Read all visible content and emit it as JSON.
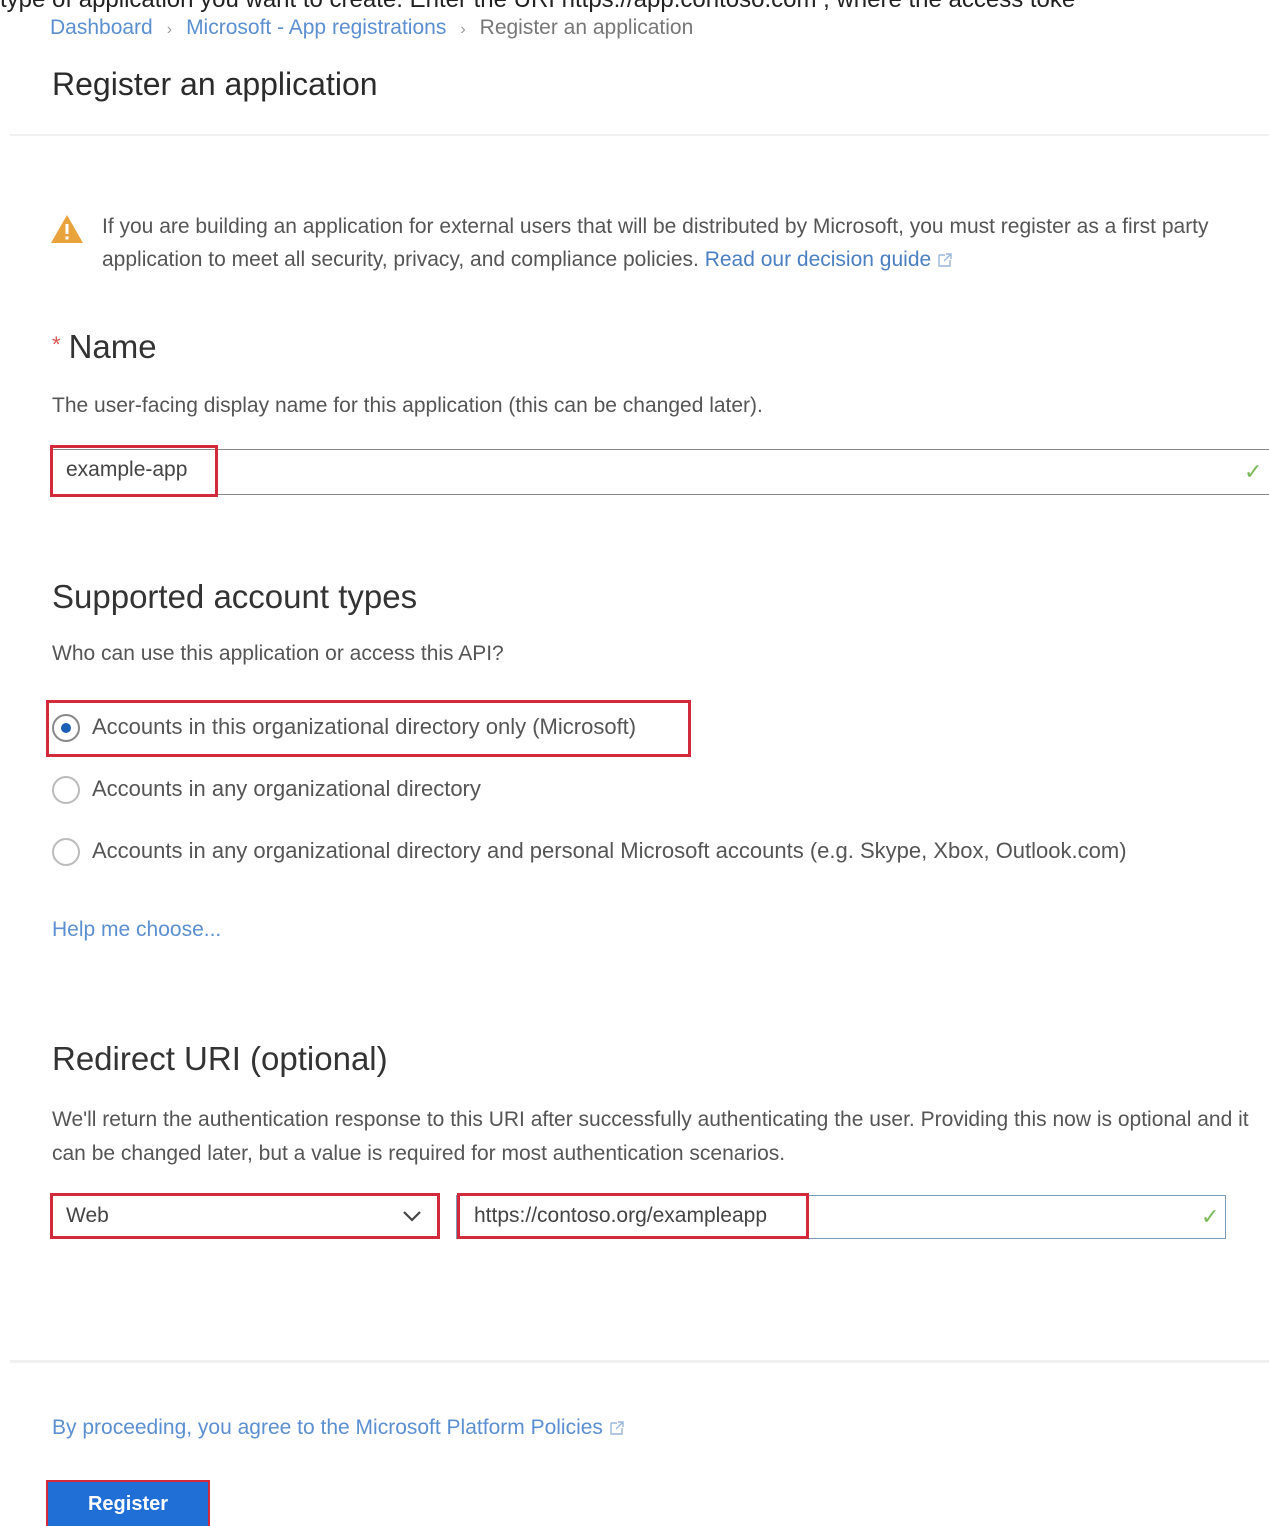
{
  "cropped_header_text": "type of application you want to create. Enter the URI https://app.contoso.com , where the access toke",
  "breadcrumb": {
    "items": [
      "Dashboard",
      "Microsoft - App registrations",
      "Register an application"
    ],
    "separator": "›"
  },
  "page_title": "Register an application",
  "notice": {
    "text": "If you are building an application for external users that will be distributed by Microsoft, you must register as a first party application to meet all security, privacy, and compliance policies.",
    "link_label": "Read our decision guide",
    "icon": "warning-icon"
  },
  "name_section": {
    "required_marker": "*",
    "title": "Name",
    "description": "The user-facing display name for this application (this can be changed later).",
    "value": "example-app",
    "valid_icon": "✓"
  },
  "account_types": {
    "title": "Supported account types",
    "question": "Who can use this application or access this API?",
    "options": [
      {
        "label": "Accounts in this organizational directory only (Microsoft)",
        "selected": true
      },
      {
        "label": "Accounts in any organizational directory",
        "selected": false
      },
      {
        "label": "Accounts in any organizational directory and personal Microsoft accounts (e.g. Skype, Xbox, Outlook.com)",
        "selected": false
      }
    ],
    "help_link": "Help me choose..."
  },
  "redirect": {
    "title": "Redirect URI (optional)",
    "description": "We'll return the authentication response to this URI after successfully authenticating the user. Providing this now is optional and it can be changed later, but a value is required for most authentication scenarios.",
    "platform_value": "Web",
    "uri_value": "https://contoso.org/exampleapp",
    "valid_icon": "✓"
  },
  "footer": {
    "policy_text": "By proceeding, you agree to the Microsoft Platform Policies",
    "register_label": "Register"
  },
  "colors": {
    "highlight": "#d22a3a",
    "link": "#5b8fd0",
    "primary_button": "#1f6fd6",
    "warning": "#e8a33d",
    "valid_check": "#7cba59"
  }
}
